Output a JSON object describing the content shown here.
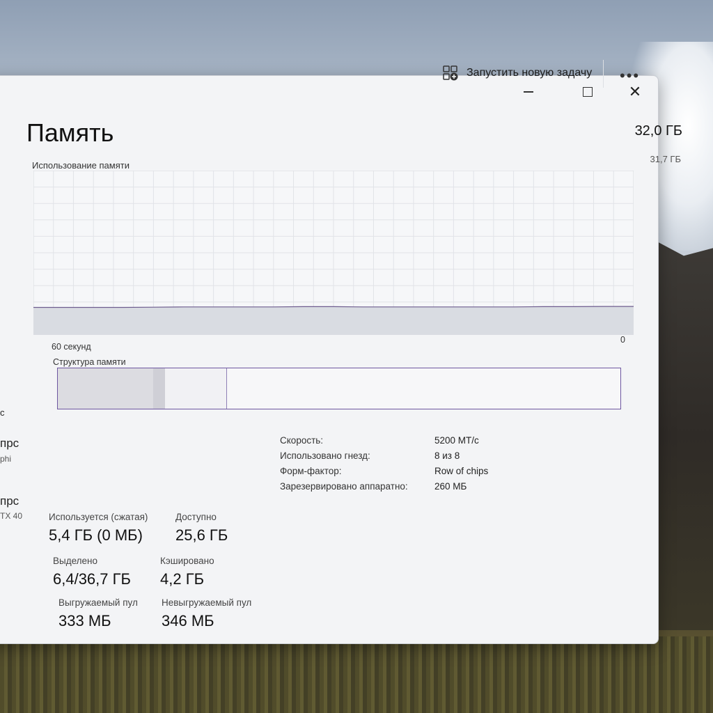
{
  "window": {
    "controls": {
      "minimize": "minimize-icon",
      "maximize": "maximize-icon",
      "close": "close-icon"
    }
  },
  "toolbar": {
    "new_task_label": "Запустить новую задачу",
    "more_label": "•••"
  },
  "memory": {
    "title": "Память",
    "total": "32,0 ГБ",
    "usage_label": "Использование памяти",
    "max_label": "31,7 ГБ",
    "axis_left": "60 секунд",
    "axis_right": "0",
    "structure_label": "Структура памяти",
    "structure": {
      "in_use_fraction": 0.17,
      "modified_fraction": 0.02,
      "standby_fraction": 0.11
    }
  },
  "chart_data": {
    "type": "area",
    "title": "Использование памяти",
    "ylim": [
      0,
      31.7
    ],
    "x_label_start": "60 секунд",
    "x_label_end": "0",
    "unit": "ГБ",
    "values": [
      5.3,
      5.3,
      5.3,
      5.3,
      5.35,
      5.4,
      5.4,
      5.4,
      5.4,
      5.45,
      5.45,
      5.4,
      5.4,
      5.4,
      5.4,
      5.4,
      5.4,
      5.45,
      5.45,
      5.5,
      5.5
    ]
  },
  "stats": [
    {
      "label": "Используется (сжатая)",
      "value": "5,4 ГБ (0 МБ)"
    },
    {
      "label": "Доступно",
      "value": "25,6 ГБ"
    },
    {
      "label": "Выделено",
      "value": "6,4/36,7 ГБ"
    },
    {
      "label": "Кэшировано",
      "value": "4,2 ГБ"
    },
    {
      "label": "Выгружаемый пул",
      "value": "333 МБ"
    },
    {
      "label": "Невыгружаемый пул",
      "value": "346 МБ"
    }
  ],
  "info": [
    {
      "key": "Скорость:",
      "value": "5200 МТ/с"
    },
    {
      "key": "Использовано гнезд:",
      "value": "8 из 8"
    },
    {
      "key": "Форм-фактор:",
      "value": "Row of chips"
    },
    {
      "key": "Зарезервировано аппаратно:",
      "value": "260 МБ"
    }
  ],
  "sidebar_fragments": [
    "с",
    "прс",
    "phi",
    "прс",
    "TX 40"
  ]
}
